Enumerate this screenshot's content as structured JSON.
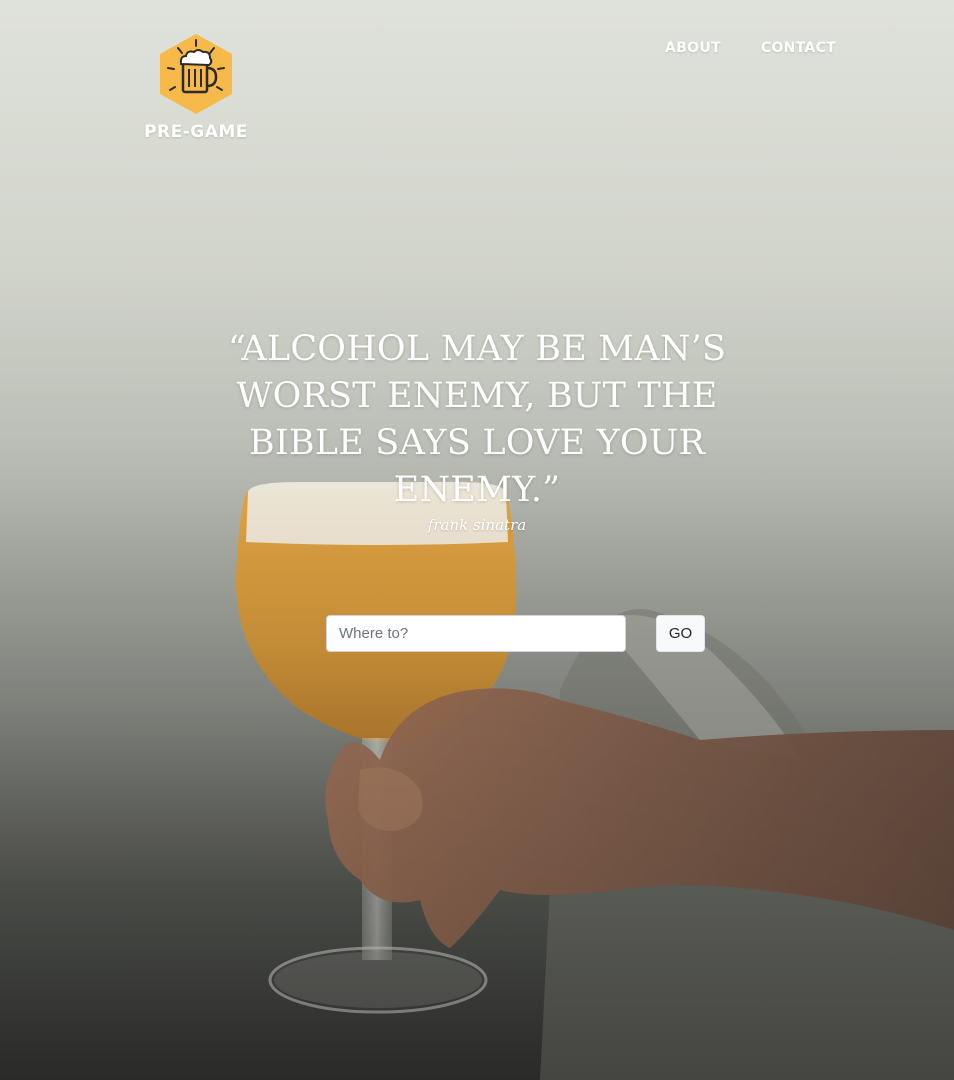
{
  "brand": {
    "name": "PRE-GAME",
    "logo_icon": "beer-mug-icon",
    "logo_color": "#f6b94a"
  },
  "nav": {
    "items": [
      {
        "label": "ABOUT"
      },
      {
        "label": "CONTACT"
      }
    ]
  },
  "hero": {
    "quote": "“ALCOHOL MAY BE MAN’S WORST ENEMY, BUT THE BIBLE SAYS LOVE YOUR ENEMY.”",
    "author": "frank sinatra",
    "background_icon": "beer-glass-hand-photo"
  },
  "search": {
    "placeholder": "Where to?",
    "value": "",
    "button_label": "GO"
  }
}
